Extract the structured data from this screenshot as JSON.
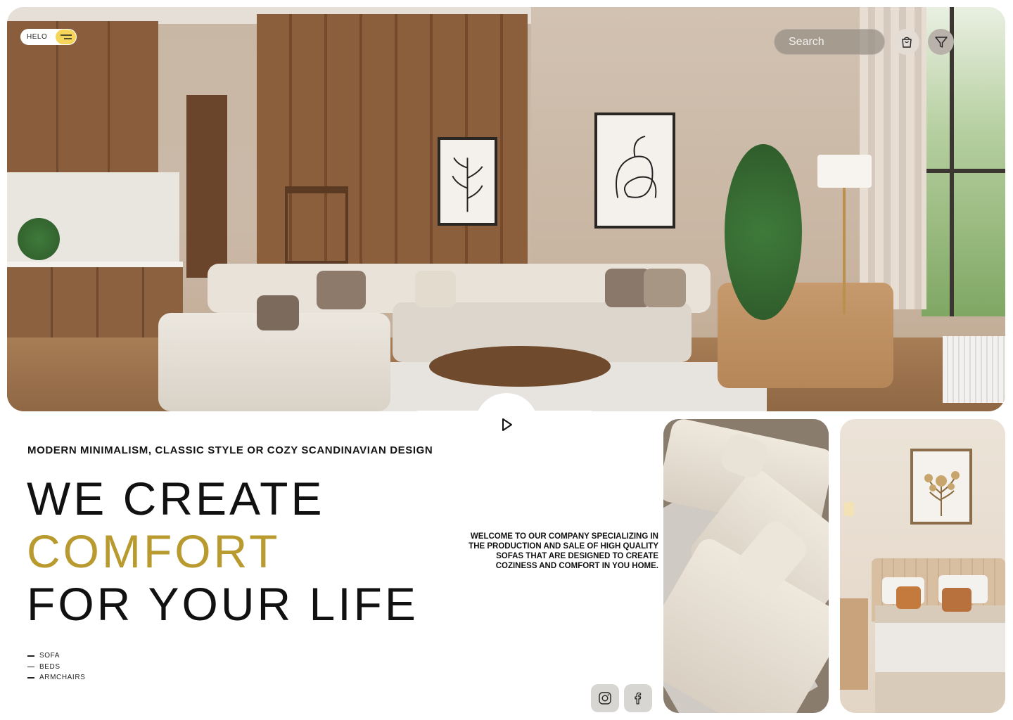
{
  "brand": {
    "logo_text": "HELO"
  },
  "header": {
    "search_placeholder": "Search"
  },
  "hero": {
    "tagline": "MODERN MINIMALISM, CLASSIC STYLE OR COZY SCANDINAVIAN DESIGN",
    "headline_line1": "WE CREATE",
    "headline_line2": "COMFORT",
    "headline_line3": "FOR YOUR LIFE"
  },
  "categories": [
    "SOFA",
    "BEDS",
    "ARMCHAIRS"
  ],
  "welcome_text": "WELCOME TO OUR COMPANY SPECIALIZING IN THE PRODUCTION AND SALE OF HIGH QUALITY SOFAS THAT ARE DESIGNED TO CREATE COZINESS AND COMFORT IN YOU HOME.",
  "icons": {
    "menu": "menu-icon",
    "cart": "cart-icon",
    "filter": "filter-icon",
    "play": "play-icon",
    "instagram": "instagram-icon",
    "facebook": "facebook-icon"
  },
  "colors": {
    "accent_gold": "#b99a2e",
    "logo_yellow": "#f5d55a",
    "text_dark": "#111111"
  }
}
